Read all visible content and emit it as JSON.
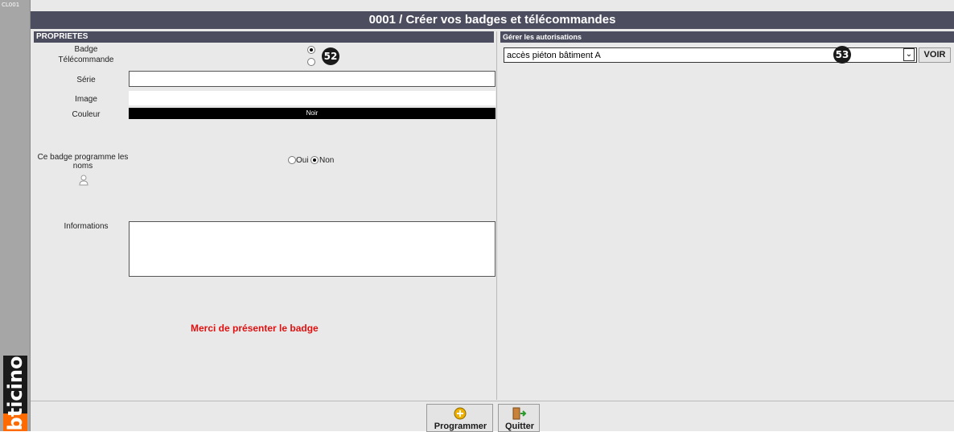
{
  "window": {
    "code": "CL001",
    "title": "0001 / Créer vos badges et télécommandes",
    "logo": "bticino"
  },
  "left_panel": {
    "section_title": "PROPRIETES",
    "type_labels": [
      "Badge",
      "Télécommande"
    ],
    "selected_type": "Badge",
    "callout_52": "52",
    "serie_label": "Série",
    "serie_value": "",
    "image_label": "Image",
    "couleur_label": "Couleur",
    "couleur_value": "Noir",
    "couleur_hex": "#000000",
    "program_names_label": "Ce badge programme les noms",
    "program_names_options": [
      "Oui",
      "Non"
    ],
    "program_names_selected": "Non",
    "informations_label": "Informations",
    "informations_value": "",
    "message": "Merci de présenter le badge",
    "message_color": "#e01010"
  },
  "right_panel": {
    "section_title": "Gérer les autorisations",
    "selected_authorization": "accès piéton bâtiment A",
    "callout_53": "53",
    "voir_label": "VOIR"
  },
  "footer": {
    "programmer_label": "Programmer",
    "quitter_label": "Quitter"
  },
  "colors": {
    "title_bar": "#4c4e60",
    "background": "#e9e9e9",
    "logo_accent": "#ff6a00"
  }
}
